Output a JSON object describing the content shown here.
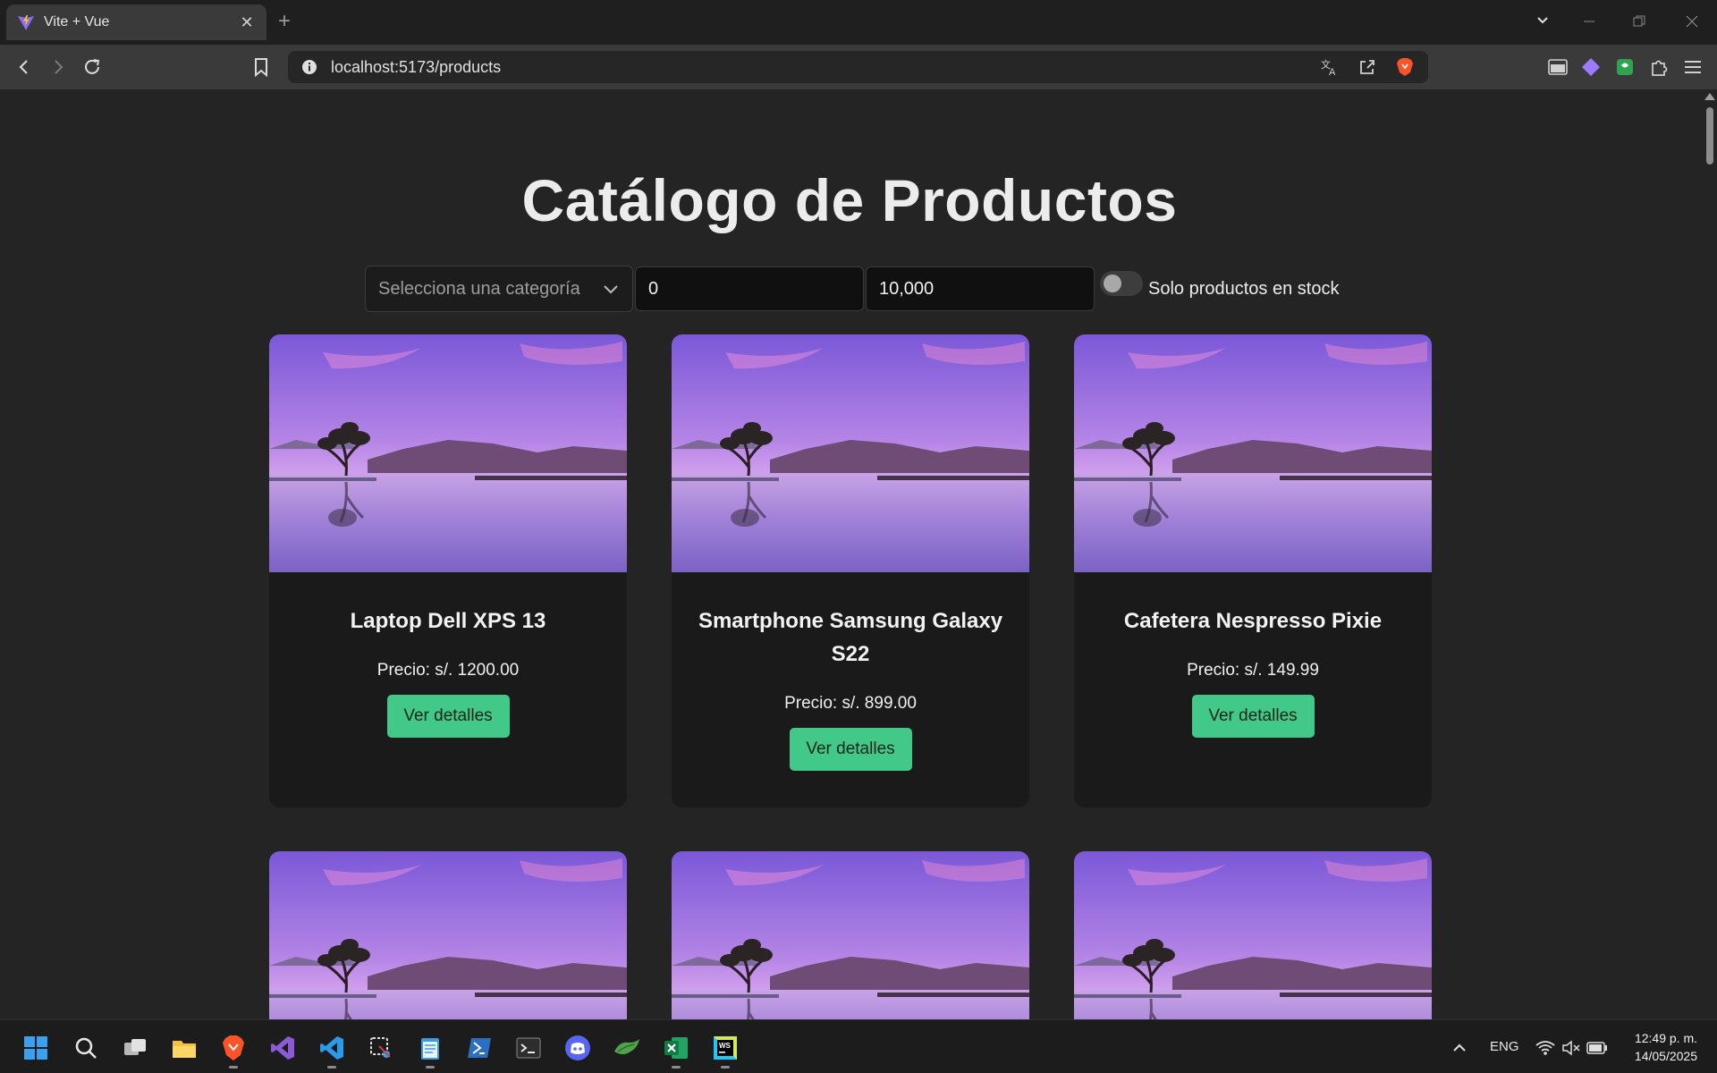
{
  "browser": {
    "tab_title": "Vite + Vue",
    "url": "localhost:5173/products"
  },
  "page": {
    "title": "Catálogo de Productos",
    "filters": {
      "category_placeholder": "Selecciona una categoría",
      "min_price": "0",
      "max_price": "10,000",
      "stock_only_label": "Solo productos en stock",
      "stock_only_checked": false
    },
    "products": [
      {
        "name": "Laptop Dell XPS 13",
        "price": "Precio: s/. 1200.00",
        "button": "Ver detalles"
      },
      {
        "name": "Smartphone Samsung Galaxy S22",
        "price": "Precio: s/. 899.00",
        "button": "Ver detalles"
      },
      {
        "name": "Cafetera Nespresso Pixie",
        "price": "Precio: s/. 149.99",
        "button": "Ver detalles"
      }
    ]
  },
  "taskbar": {
    "language": "ENG",
    "time": "12:49 p. m.",
    "date": "14/05/2025"
  },
  "colors": {
    "accent_button": "#42c98a",
    "page_background": "#242424",
    "card_background": "#1a1a1a"
  }
}
